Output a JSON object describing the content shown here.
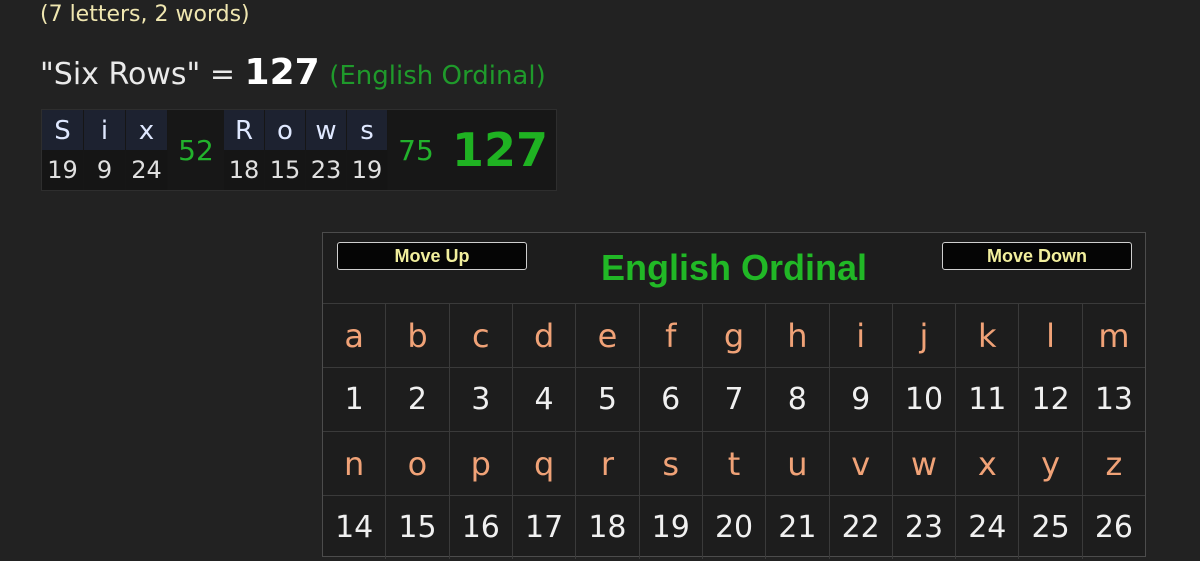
{
  "subtitle": "(7 letters, 2 words)",
  "phrase": {
    "quoted": "\"Six Rows\"",
    "equals": "=",
    "total": "127",
    "cipher": "(English Ordinal)"
  },
  "breakdown": {
    "words": [
      {
        "letters": [
          "S",
          "i",
          "x"
        ],
        "values": [
          "19",
          "9",
          "24"
        ],
        "sum": "52"
      },
      {
        "letters": [
          "R",
          "o",
          "w",
          "s"
        ],
        "values": [
          "18",
          "15",
          "23",
          "19"
        ],
        "sum": "75"
      }
    ],
    "total": "127"
  },
  "table": {
    "title": "English Ordinal",
    "move_up_label": "Move Up",
    "move_down_label": "Move Down",
    "rows": [
      {
        "letters": [
          "a",
          "b",
          "c",
          "d",
          "e",
          "f",
          "g",
          "h",
          "i",
          "j",
          "k",
          "l",
          "m"
        ],
        "values": [
          "1",
          "2",
          "3",
          "4",
          "5",
          "6",
          "7",
          "8",
          "9",
          "10",
          "11",
          "12",
          "13"
        ]
      },
      {
        "letters": [
          "n",
          "o",
          "p",
          "q",
          "r",
          "s",
          "t",
          "u",
          "v",
          "w",
          "x",
          "y",
          "z"
        ],
        "values": [
          "14",
          "15",
          "16",
          "17",
          "18",
          "19",
          "20",
          "21",
          "22",
          "23",
          "24",
          "25",
          "26"
        ]
      }
    ]
  },
  "colors": {
    "background": "#222222",
    "green_accent": "#21b826",
    "letter_orange": "#f0a277",
    "button_text": "#f2ef9d"
  }
}
